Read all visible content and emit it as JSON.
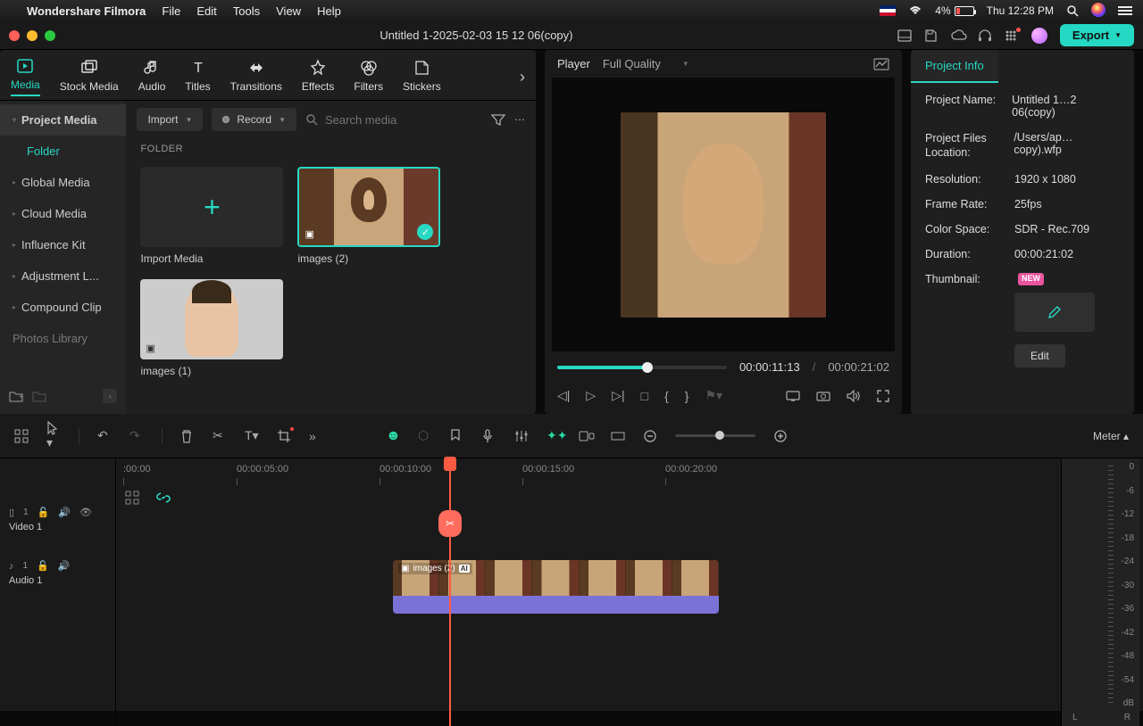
{
  "menubar": {
    "app": "Wondershare Filmora",
    "items": [
      "File",
      "Edit",
      "Tools",
      "View",
      "Help"
    ],
    "battery": "4%",
    "clock": "Thu 12:28 PM"
  },
  "window": {
    "title": "Untitled 1-2025-02-03 15 12 06(copy)",
    "export": "Export"
  },
  "media": {
    "tabs": [
      "Media",
      "Stock Media",
      "Audio",
      "Titles",
      "Transitions",
      "Effects",
      "Filters",
      "Stickers"
    ],
    "sidebar": {
      "items": [
        "Project Media",
        "Global Media",
        "Cloud Media",
        "Influence Kit",
        "Adjustment L...",
        "Compound Clip",
        "Photos Library"
      ],
      "folder": "Folder"
    },
    "toolbar": {
      "import": "Import",
      "record": "Record",
      "search_placeholder": "Search media"
    },
    "folder_label": "FOLDER",
    "items": {
      "import": "Import Media",
      "img2": "images (2)",
      "img1": "images (1)"
    }
  },
  "player": {
    "label": "Player",
    "quality": "Full Quality",
    "current": "00:00:11:13",
    "total": "00:00:21:02"
  },
  "info": {
    "tab": "Project Info",
    "rows": {
      "name_k": "Project Name:",
      "name_v": "Untitled 1…2 06(copy)",
      "loc_k": "Project Files Location:",
      "loc_v": "/Users/ap…copy).wfp",
      "res_k": "Resolution:",
      "res_v": "1920 x 1080",
      "fps_k": "Frame Rate:",
      "fps_v": "25fps",
      "cs_k": "Color Space:",
      "cs_v": "SDR - Rec.709",
      "dur_k": "Duration:",
      "dur_v": "00:00:21:02",
      "thumb_k": "Thumbnail:"
    },
    "new_badge": "NEW",
    "edit": "Edit"
  },
  "timeline": {
    "meter_label": "Meter ▴",
    "ruler": [
      ":00:00",
      "00:00:05:00",
      "00:00:10:00",
      "00:00:15:00",
      "00:00:20:00"
    ],
    "tracks": {
      "video": "Video 1",
      "audio": "Audio 1"
    },
    "clip_label": "images (2)",
    "meter_scale": [
      "0",
      "-6",
      "-12",
      "-18",
      "-24",
      "-30",
      "-36",
      "-42",
      "-48",
      "-54",
      "dB"
    ],
    "meter_lr": {
      "l": "L",
      "r": "R"
    }
  }
}
